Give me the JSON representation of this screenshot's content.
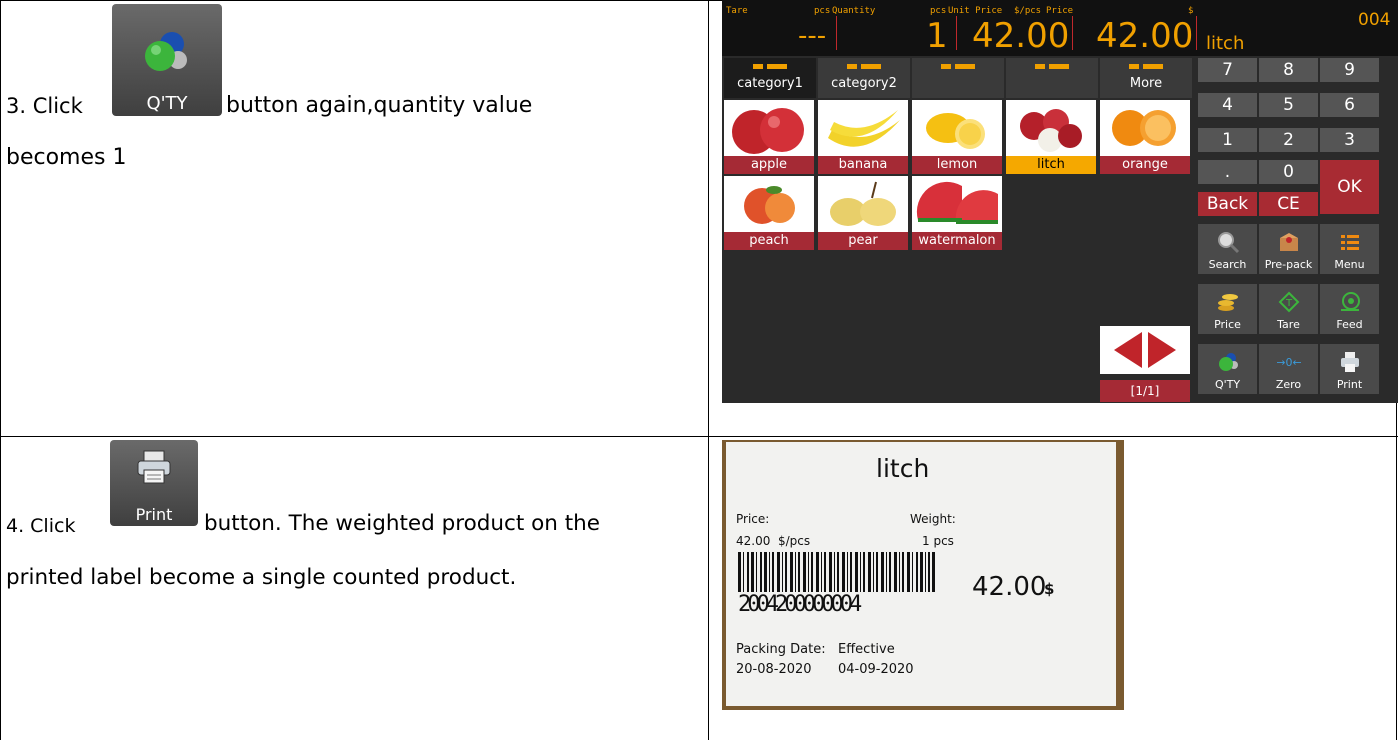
{
  "steps": [
    {
      "number_text": "3. Click",
      "button_label": "Q'TY",
      "after_text": "button again,quantity value",
      "second_line": "becomes 1"
    },
    {
      "number_text": "4. Click",
      "button_label": "Print",
      "after_text": "button. The weighted product on the",
      "second_line": "printed label become a single counted product."
    }
  ],
  "scale": {
    "topbar": {
      "tare_label": "Tare",
      "pcs_label1": "pcs",
      "quantity_label": "Quantity",
      "pcs_label2": "pcs",
      "unit_price_label": "Unit Price",
      "unit_label": "$/pcs",
      "price_label": "Price",
      "currency_label": "$",
      "tare_value": "---",
      "quantity_value": "1",
      "unit_price_value": "42.00",
      "price_value": "42.00",
      "product_name": "litch",
      "plu_number": "004"
    },
    "tabs": [
      "category1",
      "category2",
      "",
      "",
      "More"
    ],
    "products": [
      "apple",
      "banana",
      "lemon",
      "litch",
      "orange",
      "peach",
      "pear",
      "watermalon"
    ],
    "selected_product": "litch",
    "keys": [
      "7",
      "8",
      "9",
      "4",
      "5",
      "6",
      "1",
      "2",
      "3",
      ".",
      "0",
      "OK",
      "Back",
      "CE"
    ],
    "functions": [
      "Search",
      "Pre-pack",
      "Menu",
      "Price",
      "Tare",
      "Feed",
      "Q'TY",
      "Zero",
      "Print"
    ],
    "page_indicator": "[1/1]"
  },
  "label": {
    "title": "litch",
    "price_caption": "Price:",
    "weight_caption": "Weight:",
    "unit_price": "42.00  $/pcs",
    "weight": "1 pcs",
    "barcode_digits": "2004200000004",
    "total": "42.00",
    "total_currency": "$",
    "packing_caption": "Packing Date:",
    "effective_caption": "Effective",
    "packing_date": "20-08-2020",
    "effective_date": "04-09-2020"
  }
}
